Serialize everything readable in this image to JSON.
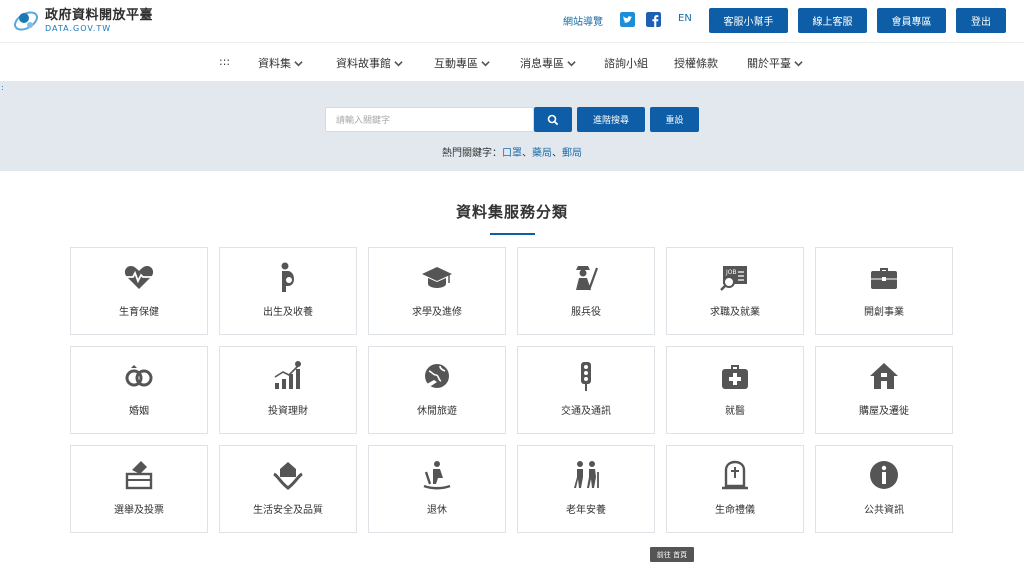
{
  "header": {
    "logo_zh": "政府資料開放平臺",
    "logo_en": "DATA.GOV.TW",
    "sitemap": "網站導覽",
    "lang": "EN",
    "buttons": [
      "客服小幫手",
      "線上客服",
      "會員專區",
      "登出"
    ]
  },
  "nav": {
    "menu": ":::",
    "items": [
      "資料集",
      "資料故事館",
      "互動專區",
      "消息專區",
      "諮詢小組",
      "授權條款",
      "關於平臺"
    ]
  },
  "search": {
    "placeholder": "請輸入關鍵字",
    "advanced": "進階搜尋",
    "reset": "重設",
    "hot_label": "熱門關鍵字：",
    "hot_keywords": [
      "口罩",
      "藥局",
      "郵局"
    ],
    "separator": "、",
    "side_marker": ":"
  },
  "section": {
    "title": "資料集服務分類"
  },
  "categories": [
    {
      "label": "生育保健",
      "icon": "heart-pulse-icon"
    },
    {
      "label": "出生及收養",
      "icon": "pregnant-icon"
    },
    {
      "label": "求學及進修",
      "icon": "graduation-cap-icon"
    },
    {
      "label": "服兵役",
      "icon": "soldier-icon"
    },
    {
      "label": "求職及就業",
      "icon": "job-search-icon"
    },
    {
      "label": "開創事業",
      "icon": "briefcase-icon"
    },
    {
      "label": "婚姻",
      "icon": "rings-icon"
    },
    {
      "label": "投資理財",
      "icon": "growth-chart-icon"
    },
    {
      "label": "休閒旅遊",
      "icon": "globe-plane-icon"
    },
    {
      "label": "交通及通訊",
      "icon": "traffic-light-icon"
    },
    {
      "label": "就醫",
      "icon": "first-aid-icon"
    },
    {
      "label": "購屋及遷徙",
      "icon": "house-icon"
    },
    {
      "label": "選舉及投票",
      "icon": "ballot-box-icon"
    },
    {
      "label": "生活安全及品質",
      "icon": "protected-home-icon"
    },
    {
      "label": "退休",
      "icon": "rocking-chair-icon"
    },
    {
      "label": "老年安養",
      "icon": "elderly-couple-icon"
    },
    {
      "label": "生命禮儀",
      "icon": "gravestone-icon"
    },
    {
      "label": "公共資訊",
      "icon": "info-icon"
    }
  ],
  "tooltip": "前往 首頁",
  "colors": {
    "primary": "#0d5ea6",
    "icon": "#555555",
    "band": "#e3e8ee"
  }
}
